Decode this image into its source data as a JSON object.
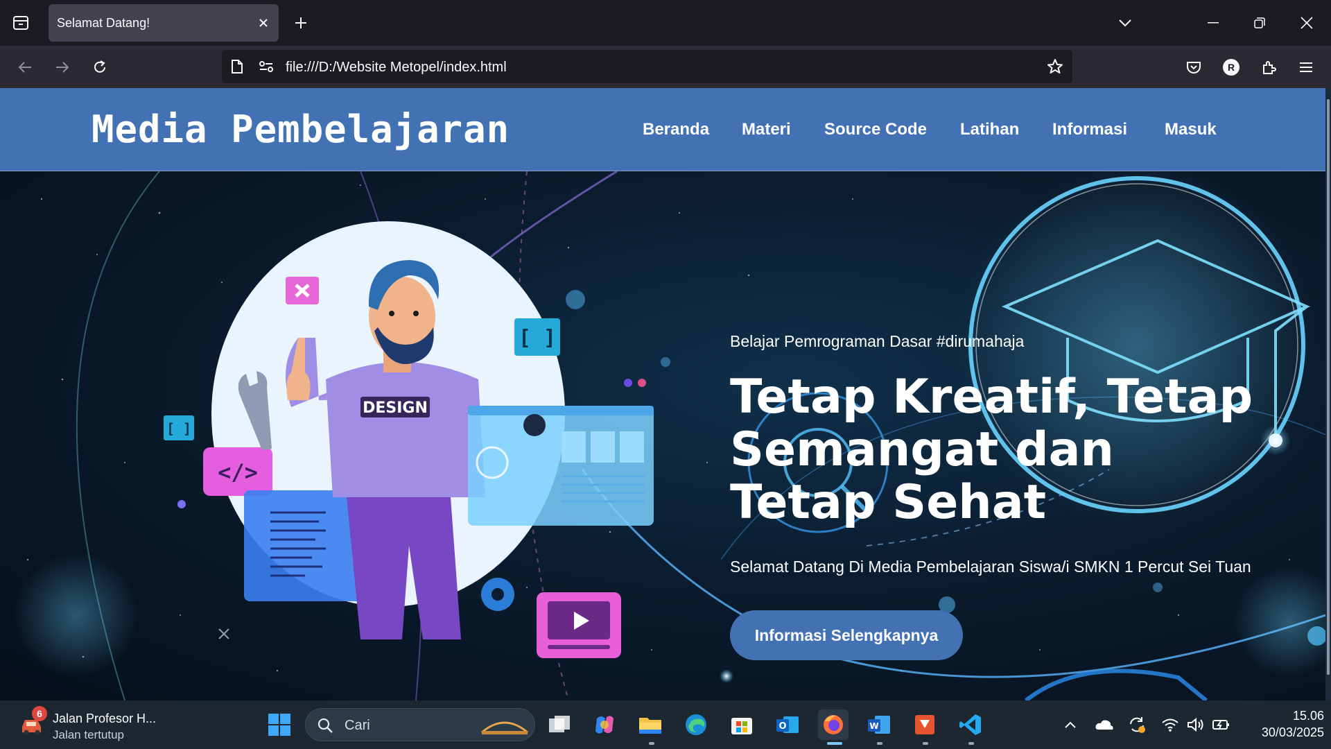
{
  "browser": {
    "tab_title": "Selamat Datang!",
    "url": "file:///D:/Website Metopel/index.html",
    "profile_initial": "R"
  },
  "site": {
    "brand": "Media Pembelajaran",
    "menu": [
      "Beranda",
      "Materi",
      "Source Code",
      "Latihan",
      "Informasi",
      "Masuk"
    ],
    "hero": {
      "subtitle": "Belajar Pemrograman Dasar #dirumahaja",
      "title": "Tetap Kreatif, Tetap Semangat dan Tetap Sehat",
      "description": "Selamat Datang Di Media Pembelajaran Siswa/i SMKN 1 Percut Sei Tuan",
      "button": "Informasi Selengkapnya",
      "illustration_label": "DESIGN"
    },
    "colors": {
      "header": "#4272b4",
      "button": "#4272b4"
    }
  },
  "taskbar": {
    "weather": {
      "title": "Jalan Profesor H...",
      "subtitle": "Jalan tertutup",
      "badge": "6"
    },
    "search_placeholder": "Cari",
    "time": "15.06",
    "date": "30/03/2025"
  }
}
